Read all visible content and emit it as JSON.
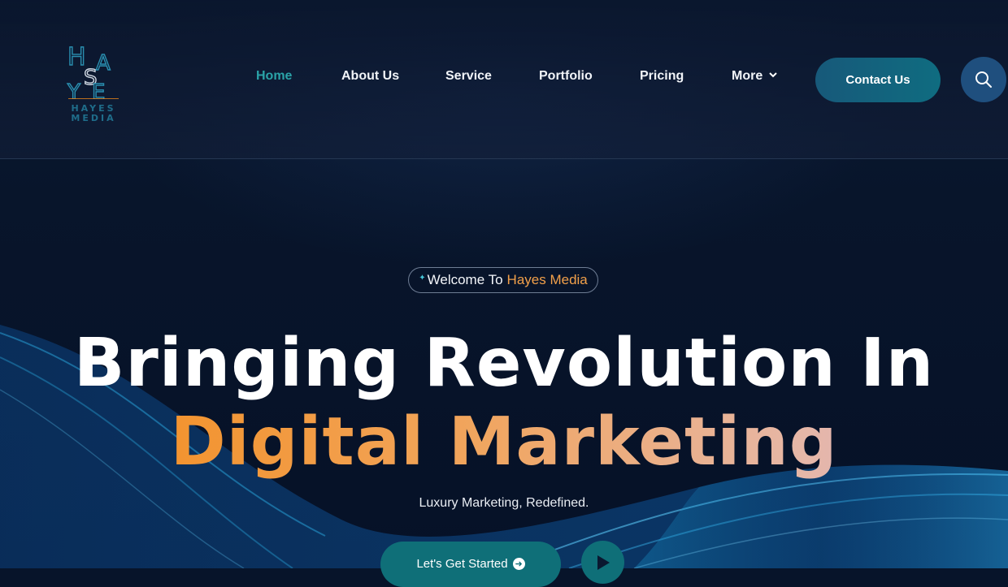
{
  "brand": {
    "logo_letters": [
      "H",
      "A",
      "S",
      "Y",
      "E"
    ],
    "name_line1": "HAYES",
    "name_line2": "MEDIA"
  },
  "nav": {
    "items": [
      {
        "label": "Home",
        "active": true
      },
      {
        "label": "About Us",
        "active": false
      },
      {
        "label": "Service",
        "active": false
      },
      {
        "label": "Portfolio",
        "active": false
      },
      {
        "label": "Pricing",
        "active": false
      },
      {
        "label": "More",
        "active": false
      }
    ],
    "contact_label": "Contact Us",
    "search_icon": "search-icon"
  },
  "hero": {
    "badge_prefix": "Welcome To",
    "badge_accent": "Hayes Media",
    "title_line1": "Bringing Revolution In",
    "title_line2": "Digital Marketing",
    "tagline": "Luxury Marketing, Redefined.",
    "cta_label": "Let's Get Started",
    "play_icon": "play-icon"
  },
  "colors": {
    "background": "#07142a",
    "accent_teal": "#2aa3a8",
    "button_teal": "#0f6f78",
    "accent_orange": "#f48a16",
    "search_bg": "#1f4f7e"
  }
}
